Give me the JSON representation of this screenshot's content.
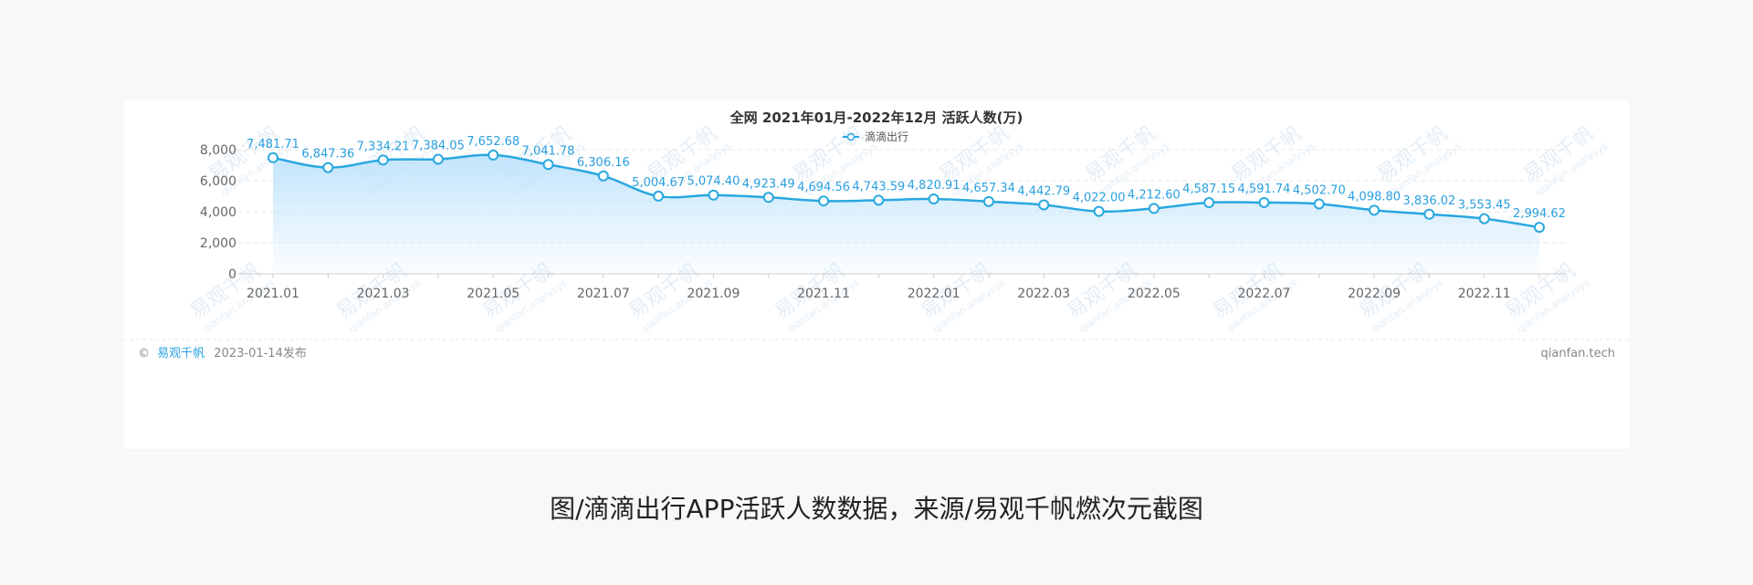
{
  "chart_data": {
    "type": "area",
    "title": "全网 2021年01月-2022年12月 活跃人数(万)",
    "legend": {
      "entries": [
        "滴滴出行"
      ],
      "position": "top-center"
    },
    "x": [
      "2021.01",
      "2021.02",
      "2021.03",
      "2021.04",
      "2021.05",
      "2021.06",
      "2021.07",
      "2021.08",
      "2021.09",
      "2021.10",
      "2021.11",
      "2021.12",
      "2022.01",
      "2022.02",
      "2022.03",
      "2022.04",
      "2022.05",
      "2022.06",
      "2022.07",
      "2022.08",
      "2022.09",
      "2022.10",
      "2022.11",
      "2022.12"
    ],
    "x_tick_labels": [
      "2021.01",
      "2021.03",
      "2021.05",
      "2021.07",
      "2021.09",
      "2021.11",
      "2022.01",
      "2022.03",
      "2022.05",
      "2022.07",
      "2022.09",
      "2022.11"
    ],
    "series": [
      {
        "name": "滴滴出行",
        "values": [
          7481.71,
          6847.36,
          7334.21,
          7384.05,
          7652.68,
          7041.78,
          6306.16,
          5004.67,
          5074.4,
          4923.49,
          4694.56,
          4743.59,
          4820.91,
          4657.34,
          4442.79,
          4022.0,
          4212.6,
          4587.15,
          4591.74,
          4502.7,
          4098.8,
          3836.02,
          3553.45,
          2994.62
        ],
        "data_labels": [
          "7,481.71",
          "6,847.36",
          "7,334.21",
          "7,384.05",
          "7,652.68",
          "7,041.78",
          "6,306.16",
          "5,004.67",
          "5,074.40",
          "4,923.49",
          "4,694.56",
          "4,743.59",
          "4,820.91",
          "4,657.34",
          "4,442.79",
          "4,022.00",
          "4,212.60",
          "4,587.15",
          "4,591.74",
          "4,502.70",
          "4,098.80",
          "3,836.02",
          "3,553.45",
          "2,994.62"
        ]
      }
    ],
    "y_tick_labels": [
      "0",
      "2,000",
      "4,000",
      "6,000",
      "8,000"
    ],
    "y_ticks": [
      0,
      2000,
      4000,
      6000,
      8000
    ],
    "ylim": [
      0,
      8000
    ],
    "grid": true,
    "colors": {
      "line": "#29a8e0",
      "area_top": "#bfe3fb",
      "label": "#2a9fe0",
      "axis_text": "#666666"
    }
  },
  "footer": {
    "copyright_symbol": "©",
    "brand": "易观千帆",
    "date_text": "2023-01-14发布",
    "site": "qianfan.tech"
  },
  "watermark": {
    "text": "易观千帆",
    "subtext": "qianfan.analysys"
  },
  "caption": "图/滴滴出行APP活跃人数数据，来源/易观千帆燃次元截图"
}
